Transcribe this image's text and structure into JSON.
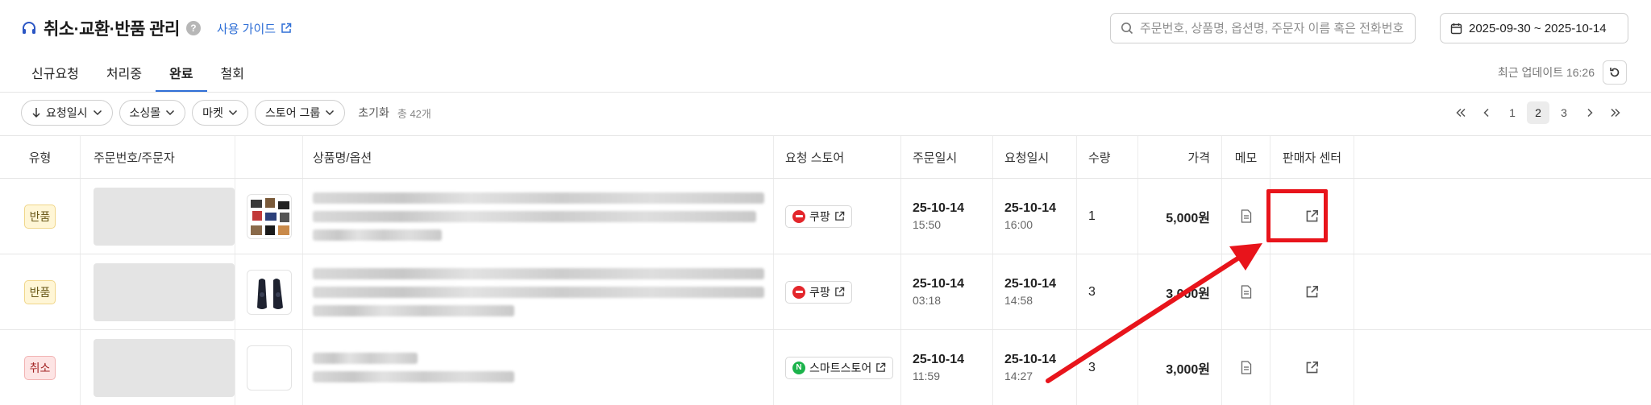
{
  "header": {
    "title": "취소·교환·반품 관리",
    "help": "?",
    "guide_label": "사용 가이드",
    "search_placeholder": "주문번호, 상품명, 옵션명, 주문자 이름 혹은 전화번호",
    "date_range": "2025-09-30 ~ 2025-10-14"
  },
  "tabs": [
    {
      "label": "신규요청",
      "active": false
    },
    {
      "label": "처리중",
      "active": false
    },
    {
      "label": "완료",
      "active": true
    },
    {
      "label": "철회",
      "active": false
    }
  ],
  "last_update": "최근 업데이트 16:26",
  "filters": {
    "sort": "요청일시",
    "sourcing": "소싱몰",
    "market": "마켓",
    "store_group": "스토어 그룹",
    "reset": "초기화",
    "total": "총 42개"
  },
  "pagination": {
    "pages": [
      "1",
      "2",
      "3"
    ],
    "current": "2"
  },
  "columns": [
    "유형",
    "주문번호/주문자",
    "",
    "상품명/옵션",
    "요청 스토어",
    "주문일시",
    "요청일시",
    "수량",
    "가격",
    "메모",
    "판매자 센터"
  ],
  "rows": [
    {
      "type": "반품",
      "type_style": "return",
      "store": "쿠팡",
      "store_logo": "coupang",
      "order_date": "25-10-14",
      "order_time": "15:50",
      "request_date": "25-10-14",
      "request_time": "16:00",
      "qty": "1",
      "price": "5,000원"
    },
    {
      "type": "반품",
      "type_style": "return",
      "store": "쿠팡",
      "store_logo": "coupang",
      "order_date": "25-10-14",
      "order_time": "03:18",
      "request_date": "25-10-14",
      "request_time": "14:58",
      "qty": "3",
      "price": "3,000원"
    },
    {
      "type": "취소",
      "type_style": "cancel",
      "store": "스마트스토어",
      "store_logo": "naver",
      "store_logo_text": "N",
      "order_date": "25-10-14",
      "order_time": "11:59",
      "request_date": "25-10-14",
      "request_time": "14:27",
      "qty": "3",
      "price": "3,000원"
    }
  ],
  "colors": {
    "accent": "#2f6fd6",
    "annotation_red": "#e8141b",
    "coupang_red": "#e3262b",
    "naver_green": "#1cb34b"
  }
}
